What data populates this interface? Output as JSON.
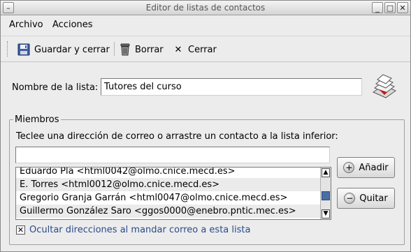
{
  "window": {
    "title": "Editor de listas de contactos",
    "menu_button_glyph": "–",
    "minimize_glyph": "_",
    "maximize_glyph": "□",
    "close_glyph": "✕"
  },
  "menubar": {
    "archivo": "Archivo",
    "acciones": "Acciones"
  },
  "toolbar": {
    "save_label": "Guardar y cerrar",
    "delete_label": "Borrar",
    "close_label": "Cerrar",
    "close_glyph": "✕"
  },
  "list_name": {
    "label": "Nombre de la lista:",
    "value": "Tutores del curso"
  },
  "members": {
    "legend": "Miembros",
    "instruction": "Teclee una dirección de correo o arrastre un contacto a la lista inferior:",
    "email_value": "",
    "items": [
      "Eduardo Pla <html0042@olmo.cnice.mecd.es>",
      "E. Torres <html0012@olmo.cnice.mecd.es>",
      "Gregorio Granja Garrán <html0047@olmo.cnice.mecd.es>",
      "Guillermo González Saro <ggos0000@enebro.pntic.mec.es>"
    ],
    "add_label": "Añadir",
    "add_glyph": "+",
    "remove_label": "Quitar",
    "remove_glyph": "−"
  },
  "scrollbar": {
    "up_glyph": "▲",
    "down_glyph": "▼"
  },
  "hide_addresses": {
    "checked_glyph": "✕",
    "label": "Ocultar direcciones al mandar correo a esta lista"
  },
  "colors": {
    "window_bg": "#ececec",
    "link_text": "#2a4a8a",
    "scroll_thumb": "#4a6fa5"
  }
}
